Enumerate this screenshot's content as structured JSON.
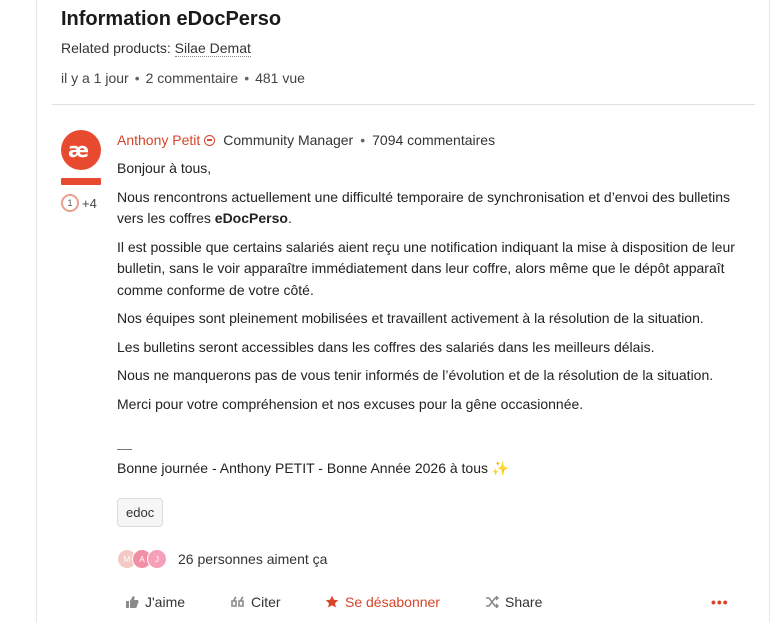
{
  "topic": {
    "title": "Information eDocPerso",
    "related_label": "Related products:",
    "related_product": "Silae Demat",
    "meta": {
      "time": "il y a 1 jour",
      "comments": "2 commentaire",
      "views": "481 vue"
    }
  },
  "post": {
    "author": "Anthony Petit",
    "role": "Community Manager",
    "comment_count": "7094 commentaires",
    "badge_rank": "1",
    "badge_extra": "+4",
    "greeting": "Bonjour à tous,",
    "p1_before": "Nous rencontrons actuellement une difficulté temporaire de synchronisation et d’envoi des bulletins vers les coffres ",
    "p1_bold": "eDocPerso",
    "p1_after": ".",
    "p2": "Il est possible que certains salariés aient reçu une notification indiquant la mise à disposition de leur bulletin, sans le voir apparaître immédiatement dans leur coffre, alors même que le dépôt apparaît comme conforme de votre côté.",
    "p3": "Nos équipes sont pleinement mobilisées et travaillent activement à la résolution de la situation.",
    "p4": "Les bulletins seront accessibles dans les coffres des salariés dans les meilleurs délais.",
    "p5": "Nous ne manquerons pas de vous tenir informés de l’évolution et de la résolution de la situation.",
    "p6": "Merci pour votre compréhension et nos excuses pour la gêne occasionnée.",
    "signature": "Bonne journée - Anthony PETIT - Bonne Année 2026 à tous ✨",
    "tag": "edoc"
  },
  "likes": {
    "faces": [
      {
        "letter": "M",
        "color": "#f2c9c3"
      },
      {
        "letter": "A",
        "color": "#f28fa6"
      },
      {
        "letter": "J",
        "color": "#f5a0b8"
      }
    ],
    "text": "26 personnes aiment ça"
  },
  "actions": {
    "like": "J'aime",
    "quote": "Citer",
    "unsubscribe": "Se désabonner",
    "share": "Share",
    "more": "•••"
  },
  "colors": {
    "accent": "#d6452a",
    "avatar_bg": "#e84a2f"
  }
}
